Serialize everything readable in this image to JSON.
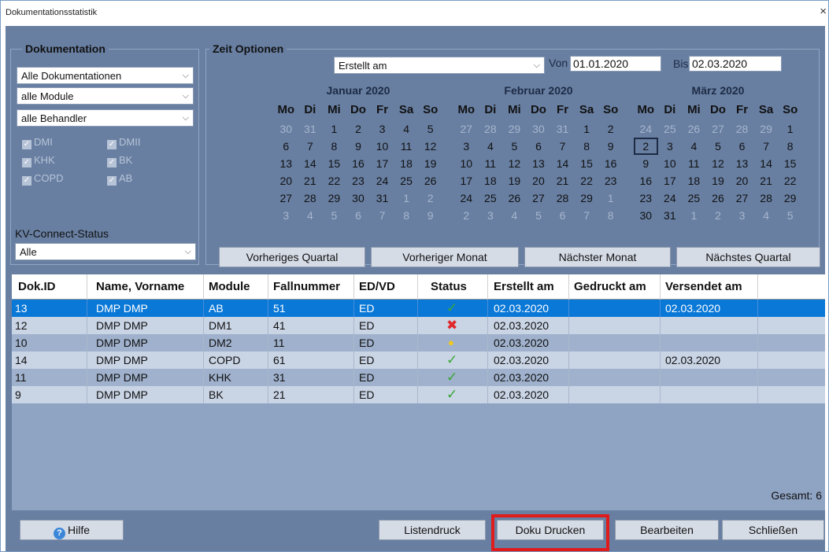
{
  "window": {
    "title": "Dokumentationsstatistik",
    "close_glyph": "×"
  },
  "doku_group": {
    "title": "Dokumentation",
    "dokumentation": "Alle Dokumentationen",
    "module": "alle Module",
    "behandler": "alle Behandler",
    "checkboxes": [
      "DMI",
      "DMII",
      "KHK",
      "BK",
      "COPD",
      "AB"
    ],
    "kv_label": "KV-Connect-Status",
    "kv_value": "Alle"
  },
  "zeit_group": {
    "title": "Zeit Optionen",
    "date_field": "Erstellt am",
    "von_label": "Von",
    "von_value": "01.01.2020",
    "bis_label": "Bis",
    "bis_value": "02.03.2020"
  },
  "weekdays": [
    "Mo",
    "Di",
    "Mi",
    "Do",
    "Fr",
    "Sa",
    "So"
  ],
  "calendars": [
    {
      "month": "Januar 2020",
      "days": [
        "30",
        "31",
        "1",
        "2",
        "3",
        "4",
        "5",
        "6",
        "7",
        "8",
        "9",
        "10",
        "11",
        "12",
        "13",
        "14",
        "15",
        "16",
        "17",
        "18",
        "19",
        "20",
        "21",
        "22",
        "23",
        "24",
        "25",
        "26",
        "27",
        "28",
        "29",
        "30",
        "31",
        "1",
        "2",
        "3",
        "4",
        "5",
        "6",
        "7",
        "8",
        "9"
      ],
      "other": [
        0,
        1,
        33,
        34,
        35,
        36,
        37,
        38,
        39,
        40,
        41
      ]
    },
    {
      "month": "Februar 2020",
      "days": [
        "27",
        "28",
        "29",
        "30",
        "31",
        "1",
        "2",
        "3",
        "4",
        "5",
        "6",
        "7",
        "8",
        "9",
        "10",
        "11",
        "12",
        "13",
        "14",
        "15",
        "16",
        "17",
        "18",
        "19",
        "20",
        "21",
        "22",
        "23",
        "24",
        "25",
        "26",
        "27",
        "28",
        "29",
        "1",
        "2",
        "3",
        "4",
        "5",
        "6",
        "7",
        "8"
      ],
      "other": [
        0,
        1,
        2,
        3,
        4,
        34,
        35,
        36,
        37,
        38,
        39,
        40,
        41
      ]
    },
    {
      "month": "März 2020",
      "days": [
        "24",
        "25",
        "26",
        "27",
        "28",
        "29",
        "1",
        "2",
        "3",
        "4",
        "5",
        "6",
        "7",
        "8",
        "9",
        "10",
        "11",
        "12",
        "13",
        "14",
        "15",
        "16",
        "17",
        "18",
        "19",
        "20",
        "21",
        "22",
        "23",
        "24",
        "25",
        "26",
        "27",
        "28",
        "29",
        "30",
        "31",
        "1",
        "2",
        "3",
        "4",
        "5"
      ],
      "other": [
        0,
        1,
        2,
        3,
        4,
        5,
        37,
        38,
        39,
        40,
        41
      ],
      "selected": 7
    }
  ],
  "nav_buttons": [
    "Vorheriges Quartal",
    "Vorheriger Monat",
    "Nächster Monat",
    "Nächstes Quartal"
  ],
  "table": {
    "headers": [
      "Dok.ID",
      "Name, Vorname",
      "Module",
      "Fallnummer",
      "ED/VD",
      "Status",
      "Erstellt am",
      "Gedruckt am",
      "Versendet am"
    ],
    "rows": [
      {
        "id": "13",
        "name": "DMP DMP",
        "module": "AB",
        "fall": "51",
        "edvd": "ED",
        "status": "ok",
        "erstellt": "02.03.2020",
        "gedruckt": "",
        "versendet": "02.03.2020"
      },
      {
        "id": "12",
        "name": "DMP DMP",
        "module": "DM1",
        "fall": "41",
        "edvd": "ED",
        "status": "error",
        "erstellt": "02.03.2020",
        "gedruckt": "",
        "versendet": ""
      },
      {
        "id": "10",
        "name": "DMP DMP",
        "module": "DM2",
        "fall": "11",
        "edvd": "ED",
        "status": "pending",
        "erstellt": "02.03.2020",
        "gedruckt": "",
        "versendet": ""
      },
      {
        "id": "14",
        "name": "DMP DMP",
        "module": "COPD",
        "fall": "61",
        "edvd": "ED",
        "status": "ok",
        "erstellt": "02.03.2020",
        "gedruckt": "",
        "versendet": "02.03.2020"
      },
      {
        "id": "11",
        "name": "DMP DMP",
        "module": "KHK",
        "fall": "31",
        "edvd": "ED",
        "status": "ok",
        "erstellt": "02.03.2020",
        "gedruckt": "",
        "versendet": ""
      },
      {
        "id": "9",
        "name": "DMP DMP",
        "module": "BK",
        "fall": "21",
        "edvd": "ED",
        "status": "ok",
        "erstellt": "02.03.2020",
        "gedruckt": "",
        "versendet": ""
      }
    ],
    "selected_row": 0
  },
  "status_icons": {
    "ok": "checkmark-icon",
    "error": "cross-icon",
    "pending": "circle-icon"
  },
  "total": "Gesamt: 6",
  "footer": {
    "hilfe": "Hilfe",
    "listendruck": "Listendruck",
    "doku_drucken": "Doku Drucken",
    "bearbeiten": "Bearbeiten",
    "schliessen": "Schließen"
  },
  "colors": {
    "selection": "#0a78d7",
    "highlight": "#e01b1b",
    "client": "#687fa2"
  }
}
